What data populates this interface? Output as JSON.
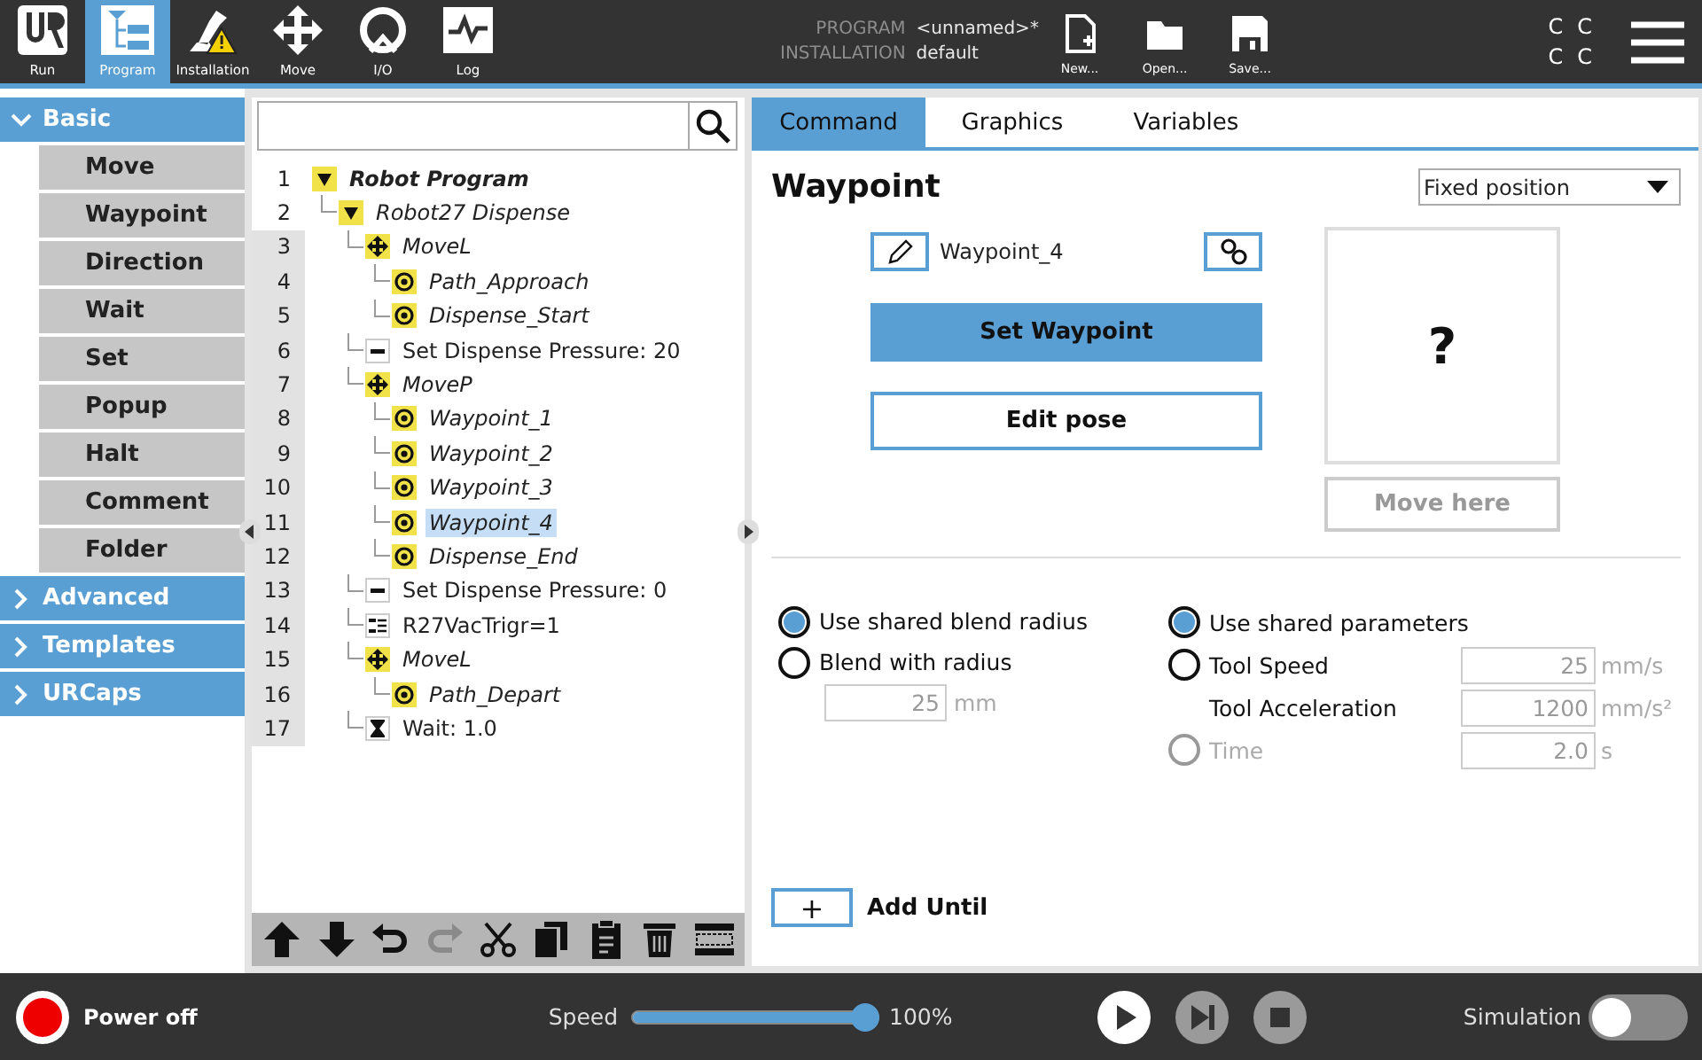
{
  "top_bar": {
    "nav": [
      {
        "label": "Run",
        "selected": false
      },
      {
        "label": "Program",
        "selected": true
      },
      {
        "label": "Installation",
        "selected": false
      },
      {
        "label": "Move",
        "selected": false
      },
      {
        "label": "I/O",
        "selected": false
      },
      {
        "label": "Log",
        "selected": false
      }
    ],
    "program_label": "PROGRAM",
    "program_value": "<unnamed>*",
    "installation_label": "INSTALLATION",
    "installation_value": "default",
    "file_actions": [
      {
        "label": "New..."
      },
      {
        "label": "Open..."
      },
      {
        "label": "Save..."
      }
    ],
    "status_letters": [
      "C",
      "C",
      "C",
      "C"
    ]
  },
  "sidebar": {
    "groups": [
      {
        "label": "Basic",
        "expanded": true,
        "items": [
          "Move",
          "Waypoint",
          "Direction",
          "Wait",
          "Set",
          "Popup",
          "Halt",
          "Comment",
          "Folder"
        ]
      },
      {
        "label": "Advanced",
        "expanded": false
      },
      {
        "label": "Templates",
        "expanded": false
      },
      {
        "label": "URCaps",
        "expanded": false
      }
    ]
  },
  "tree": {
    "rows": [
      {
        "line": "1",
        "label": "Robot Program",
        "kind": "program",
        "expanded": true,
        "selected": false,
        "children": [
          {
            "line": "2",
            "label": "Robot27 Dispense",
            "kind": "folder",
            "expanded": true,
            "selected": false,
            "children": [
              {
                "line": "3",
                "label": "MoveL",
                "kind": "move",
                "selected": false,
                "children": [
                  {
                    "line": "4",
                    "label": "Path_Approach",
                    "kind": "waypoint",
                    "selected": false
                  },
                  {
                    "line": "5",
                    "label": "Dispense_Start",
                    "kind": "waypoint",
                    "selected": false
                  }
                ]
              },
              {
                "line": "6",
                "label": "Set Dispense Pressure: 20",
                "kind": "set",
                "selected": false
              },
              {
                "line": "7",
                "label": "MoveP",
                "kind": "move",
                "selected": false,
                "children": [
                  {
                    "line": "8",
                    "label": "Waypoint_1",
                    "kind": "waypoint",
                    "selected": false
                  },
                  {
                    "line": "9",
                    "label": "Waypoint_2",
                    "kind": "waypoint",
                    "selected": false
                  },
                  {
                    "line": "10",
                    "label": "Waypoint_3",
                    "kind": "waypoint",
                    "selected": false
                  },
                  {
                    "line": "11",
                    "label": "Waypoint_4",
                    "kind": "waypoint",
                    "selected": true
                  },
                  {
                    "line": "12",
                    "label": "Dispense_End",
                    "kind": "waypoint",
                    "selected": false
                  }
                ]
              },
              {
                "line": "13",
                "label": "Set Dispense Pressure: 0",
                "kind": "set",
                "selected": false
              },
              {
                "line": "14",
                "label": "R27VacTrigr=1",
                "kind": "assign",
                "selected": false
              },
              {
                "line": "15",
                "label": "MoveL",
                "kind": "move",
                "selected": false,
                "children": [
                  {
                    "line": "16",
                    "label": "Path_Depart",
                    "kind": "waypoint",
                    "selected": false
                  }
                ]
              },
              {
                "line": "17",
                "label": "Wait: 1.0",
                "kind": "wait",
                "selected": false
              }
            ]
          }
        ]
      }
    ],
    "toolbar": [
      {
        "disabled": false
      },
      {
        "disabled": false
      },
      {
        "disabled": false
      },
      {
        "disabled": true
      },
      {
        "disabled": false
      },
      {
        "disabled": false
      },
      {
        "disabled": false
      },
      {
        "disabled": false
      },
      {
        "disabled": false
      }
    ]
  },
  "command_panel": {
    "tabs": [
      {
        "label": "Command",
        "selected": true
      },
      {
        "label": "Graphics",
        "selected": false
      },
      {
        "label": "Variables",
        "selected": false
      }
    ],
    "title": "Waypoint",
    "position_mode": "Fixed position",
    "waypoint_name": "Waypoint_4",
    "set_button": "Set Waypoint",
    "edit_button": "Edit pose",
    "preview_mark": "?",
    "move_button": {
      "label": "Move here",
      "disabled": true
    },
    "blend_options": [
      {
        "label": "Use shared blend radius",
        "selected": true
      },
      {
        "label": "Blend with radius",
        "selected": false
      }
    ],
    "blend_radius": {
      "value": "25",
      "unit": "mm"
    },
    "parameters": [
      {
        "kind": "radio",
        "label": "Use shared parameters",
        "selected": true,
        "disabled": false
      },
      {
        "kind": "radio",
        "label": "Tool Speed",
        "selected": false,
        "disabled": false,
        "value": "25",
        "unit": "mm/s"
      },
      {
        "kind": "plain",
        "label": "Tool Acceleration",
        "value": "1200",
        "unit": "mm/s²"
      },
      {
        "kind": "radio",
        "label": "Time",
        "selected": false,
        "disabled": true,
        "value": "2.0",
        "unit": "s"
      }
    ],
    "add_until": {
      "button": "+",
      "label": "Add Until"
    }
  },
  "bottom_bar": {
    "power": "Power off",
    "speed_label": "Speed",
    "speed": {
      "level": 1.0,
      "reading": "100%"
    },
    "controls": [
      {
        "disabled": false
      },
      {
        "disabled": true
      },
      {
        "disabled": true
      }
    ],
    "simulation": {
      "label": "Simulation",
      "on": false
    }
  }
}
